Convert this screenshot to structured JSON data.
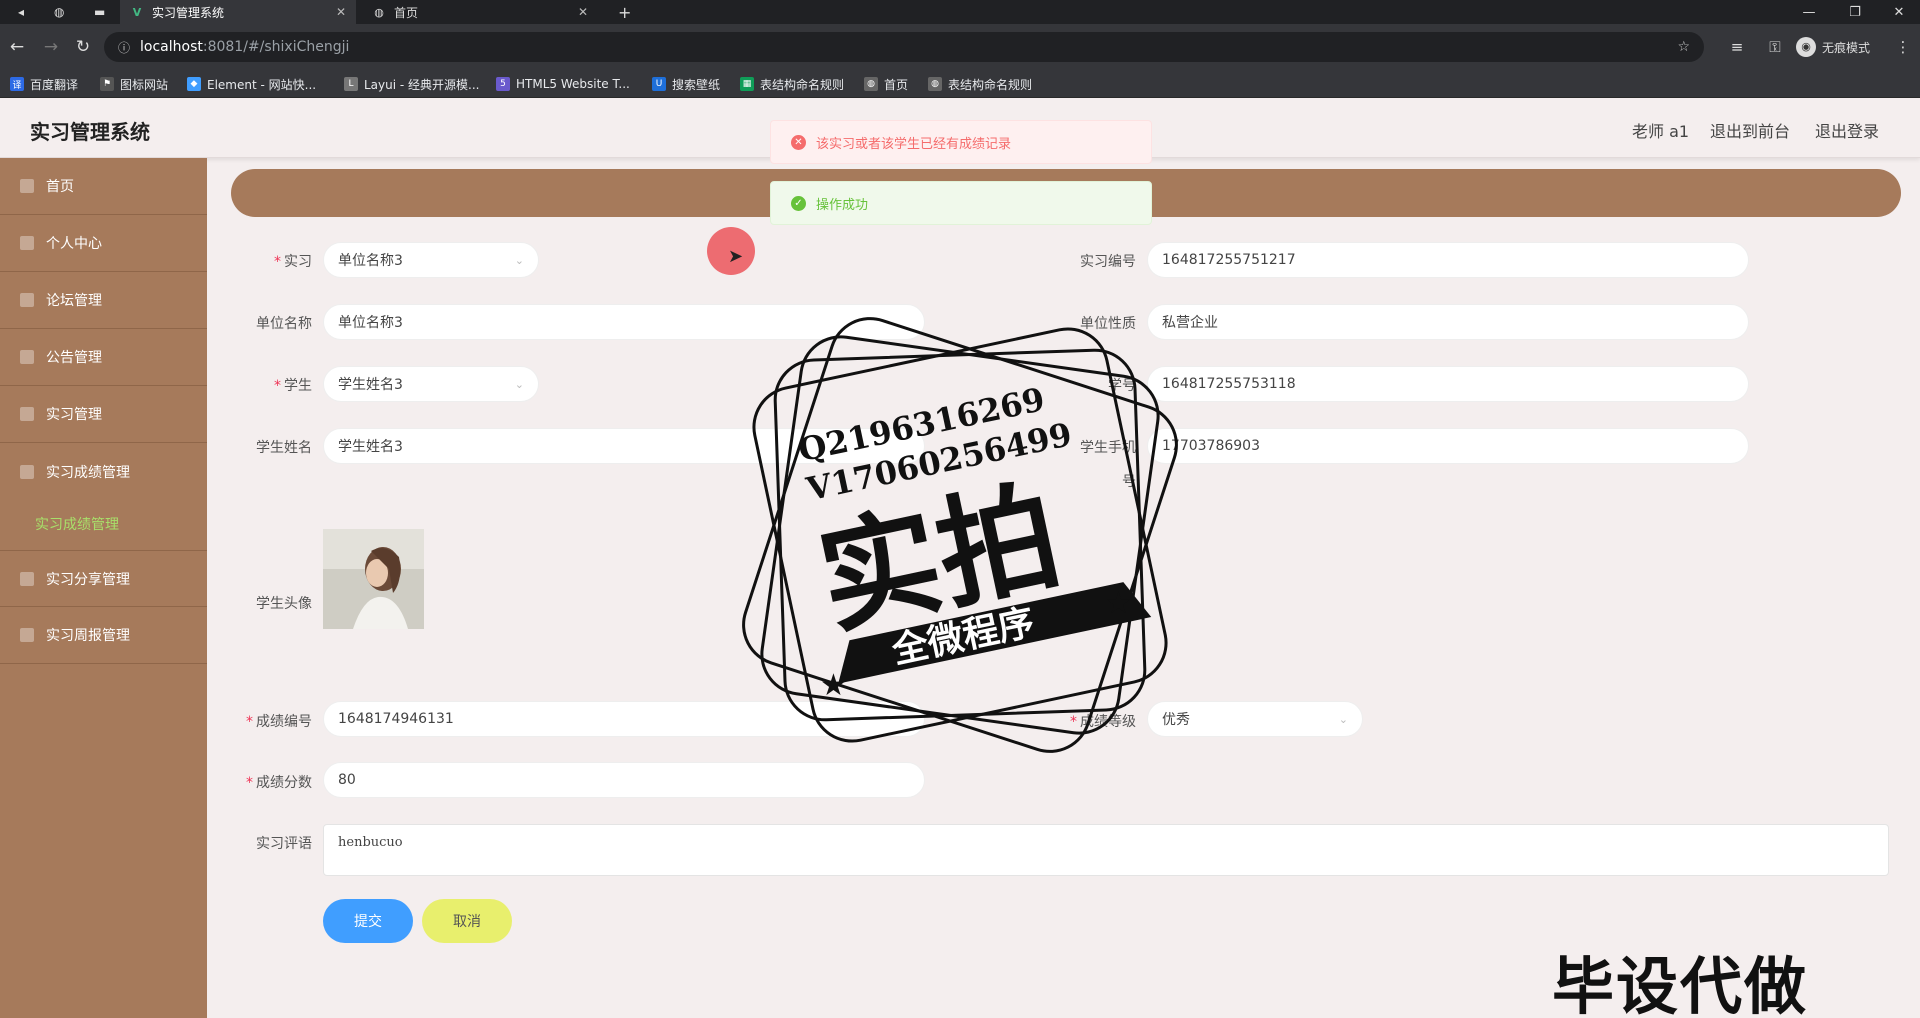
{
  "browser": {
    "tabs": [
      {
        "label": "实习管理系统",
        "icon": "vue-icon",
        "active": true
      },
      {
        "label": "首页",
        "icon": "globe-icon",
        "active": false
      }
    ],
    "url_host": "localhost",
    "url_path": ":8081/#/shixiChengji",
    "incognito_label": "无痕模式",
    "bookmarks": [
      {
        "label": "百度翻译",
        "icon": "translate-icon",
        "color": "#2d6ae5"
      },
      {
        "label": "图标网站",
        "icon": "flag-icon",
        "color": "#555555"
      },
      {
        "label": "Element - 网站快...",
        "icon": "element-icon",
        "color": "#409eff"
      },
      {
        "label": "Layui - 经典开源模...",
        "icon": "layui-icon",
        "color": "#777777"
      },
      {
        "label": "HTML5 Website T...",
        "icon": "html5-icon",
        "color": "#6a5acd"
      },
      {
        "label": "搜索壁纸",
        "icon": "wallpaper-icon",
        "color": "#1e6fd9"
      },
      {
        "label": "表结构命名规则",
        "icon": "sheet-icon",
        "color": "#0f9d58"
      },
      {
        "label": "首页",
        "icon": "globe-icon",
        "color": "#666666"
      },
      {
        "label": "表结构命名规则",
        "icon": "globe-icon",
        "color": "#666666"
      }
    ]
  },
  "header": {
    "title": "实习管理系统",
    "user": "老师 a1",
    "front_link": "退出到前台",
    "logout": "退出登录"
  },
  "sidebar": {
    "items": [
      {
        "label": "首页",
        "icon": "home-icon"
      },
      {
        "label": "个人中心",
        "icon": "user-icon"
      },
      {
        "label": "论坛管理",
        "icon": "forum-icon"
      },
      {
        "label": "公告管理",
        "icon": "notice-icon"
      },
      {
        "label": "实习管理",
        "icon": "book-icon"
      },
      {
        "label": "实习成绩管理",
        "icon": "grade-icon"
      },
      {
        "label": "实习分享管理",
        "icon": "share-icon"
      },
      {
        "label": "实习周报管理",
        "icon": "report-icon"
      }
    ],
    "sub_active": "实习成绩管理"
  },
  "toasts": {
    "error": "该实习或者该学生已经有成绩记录",
    "success": "操作成功"
  },
  "form": {
    "shixi": {
      "label": "实习",
      "value": "单位名称3"
    },
    "shixi_bianhao": {
      "label": "实习编号",
      "value": "164817255751217"
    },
    "danwei_mingcheng": {
      "label": "单位名称",
      "value": "单位名称3"
    },
    "danwei_xingzhi": {
      "label": "单位性质",
      "value": "私营企业"
    },
    "xuesheng": {
      "label": "学生",
      "value": "学生姓名3"
    },
    "xuehao": {
      "label": "学号",
      "value": "164817255753118"
    },
    "xuesheng_xingming": {
      "label": "学生姓名",
      "value": "学生姓名3"
    },
    "xuesheng_shouji": {
      "label1": "学生手机",
      "label2": "号",
      "value": "17703786903"
    },
    "touxiang": {
      "label": "学生头像"
    },
    "chengji_bianhao": {
      "label": "成绩编号",
      "value": "1648174946131"
    },
    "chengji_dengji": {
      "label": "成绩等级",
      "value": "优秀"
    },
    "chengji_fenshu": {
      "label": "成绩分数",
      "value": "80"
    },
    "pingyu": {
      "label": "实习评语",
      "value": "henbucuo"
    },
    "submit": "提交",
    "cancel": "取消"
  },
  "watermark": {
    "line1": "Q2196316269",
    "line2": "V17060256499",
    "big": "实拍",
    "ribbon": "全微程序",
    "corner": "毕设代做"
  }
}
